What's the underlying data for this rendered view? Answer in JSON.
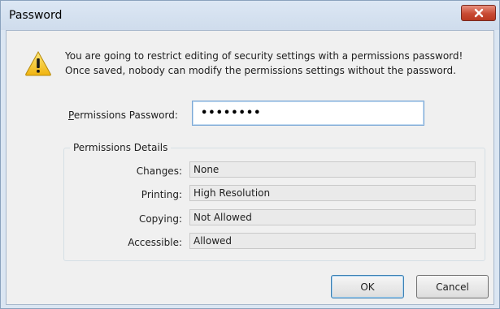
{
  "window": {
    "title": "Password"
  },
  "message": {
    "line1": "You are going to restrict editing of security settings with a permissions password!",
    "line2": "Once saved, nobody can modify the permissions settings without the password."
  },
  "password": {
    "label_mnemonic": "P",
    "label_rest": "ermissions Password:",
    "value": "••••••••"
  },
  "details": {
    "title": "Permissions Details",
    "rows": [
      {
        "label": "Changes:",
        "value": "None"
      },
      {
        "label": "Printing:",
        "value": "High Resolution"
      },
      {
        "label": "Copying:",
        "value": "Not Allowed"
      },
      {
        "label": "Accessible:",
        "value": "Allowed"
      }
    ]
  },
  "buttons": {
    "ok": "OK",
    "cancel": "Cancel"
  },
  "icons": {
    "warning": "warning-icon",
    "close": "close-icon"
  },
  "colors": {
    "close_button": "#c84a33",
    "warning_triangle": "#f4c61f"
  }
}
